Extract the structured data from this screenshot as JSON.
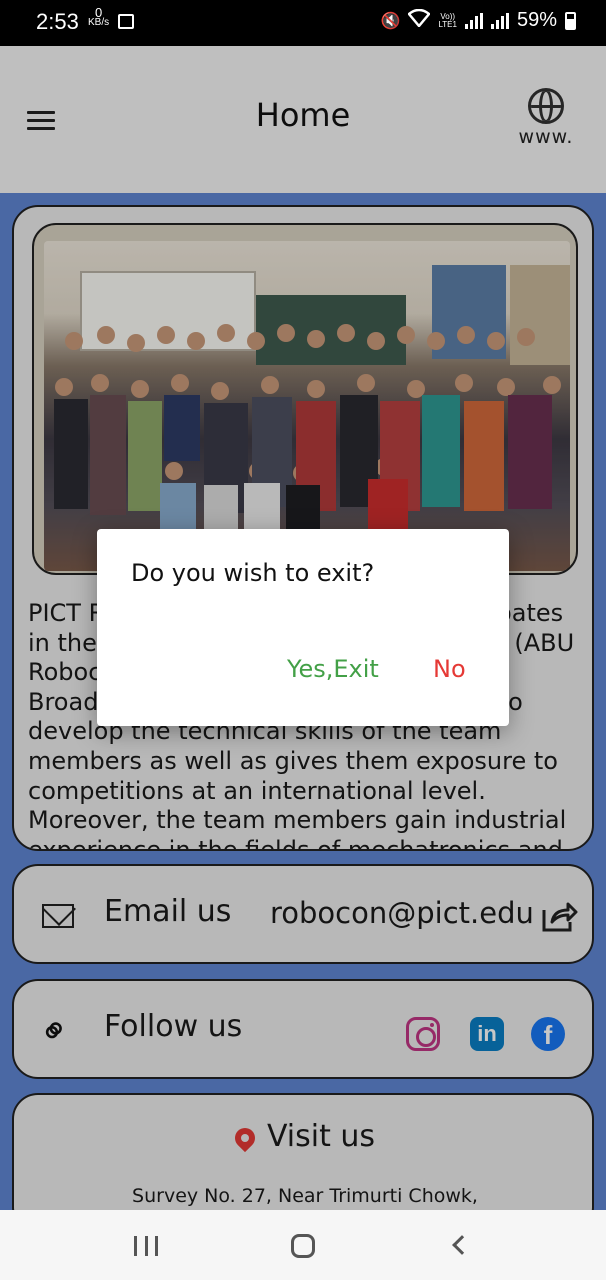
{
  "status_bar": {
    "time": "2:53",
    "net_speed_value": "0",
    "net_speed_unit": "KB/s",
    "volte_label": "Vo))",
    "lte_label": "LTE1",
    "battery": "59%"
  },
  "app_bar": {
    "title": "Home",
    "www_label": "www."
  },
  "about": {
    "text": "PICT Robocon is the team which participates in the annual Asia-Pacific Robot Contest (ABU Robocon), founded by the Asia-Pacific Broadcasting Union. The contest helps to develop the technical skills of the team members as well as gives them exposure to competitions at an international level. Moreover, the team members gain industrial experience in the fields of mechatronics and hardware coding."
  },
  "email": {
    "label": "Email us",
    "value": "robocon@pict.edu"
  },
  "follow": {
    "label": "Follow us",
    "linkedin_glyph": "in",
    "facebook_glyph": "f"
  },
  "visit": {
    "label": "Visit us",
    "address": "Survey No. 27, Near Trimurti Chowk,"
  },
  "dialog": {
    "message": "Do you wish to exit?",
    "yes_label": "Yes,Exit",
    "no_label": "No"
  },
  "colors": {
    "background_blue": "#5f86d3",
    "yes_green": "#43a047",
    "no_red": "#e53935"
  }
}
